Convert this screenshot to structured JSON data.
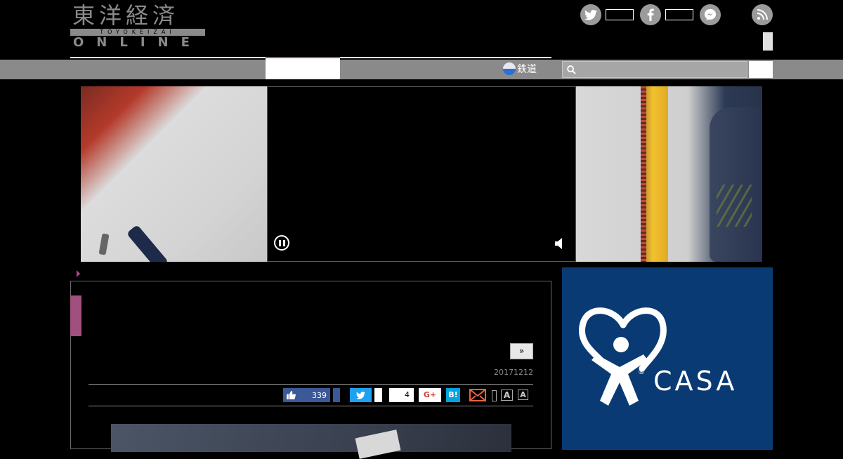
{
  "header": {
    "logo_kanji": "東洋経済",
    "logo_romaji": "TOYOKEIZAI",
    "logo_online": "ONLINE",
    "social": [
      {
        "icon": "twitter-icon",
        "color": "#9b9b9b"
      },
      {
        "icon": "facebook-icon",
        "color": "#9b9b9b"
      },
      {
        "icon": "messenger-icon",
        "color": "#9b9b9b"
      },
      {
        "icon": "rss-icon",
        "color": "#9b9b9b"
      }
    ]
  },
  "nav": {
    "rail_label": "鉄道",
    "accent_color": "#b04a8a"
  },
  "hero": {
    "video_controls": {
      "pause_icon": "pause-icon",
      "volume_icon": "volume-icon"
    }
  },
  "article": {
    "next_label": "»",
    "date": "20171212",
    "share": {
      "like_count": "339",
      "pocket_count": "4",
      "gplus_label": "G+",
      "hatena_label": "B!"
    },
    "font_size_labels": [
      "A",
      "A"
    ]
  },
  "ad": {
    "brand": "CASA",
    "reg_mark": "®",
    "background": "#0a3a73"
  }
}
